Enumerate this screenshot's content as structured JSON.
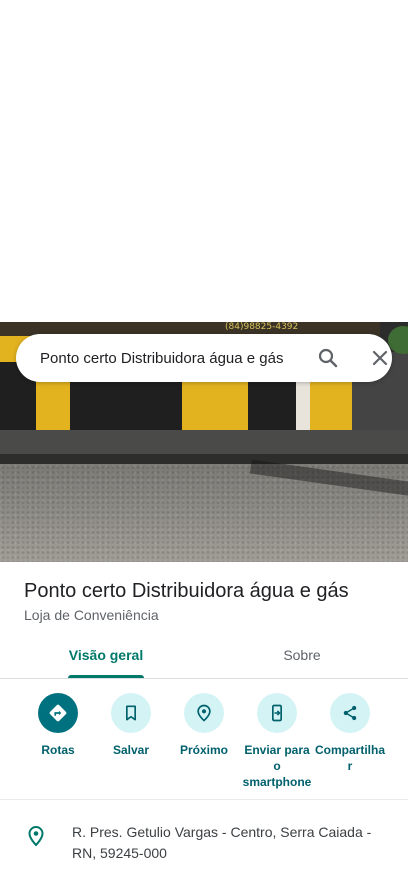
{
  "search": {
    "value": "Ponto certo Distribuidora água e gás",
    "icons": {
      "search": "search-icon",
      "close": "close-icon"
    }
  },
  "photo": {
    "sign_text": "(84)98825-4392"
  },
  "place": {
    "name": "Ponto certo Distribuidora água e gás",
    "category": "Loja de Conveniência"
  },
  "tabs": [
    {
      "label": "Visão geral",
      "selected": true
    },
    {
      "label": "Sobre",
      "selected": false
    }
  ],
  "actions": [
    {
      "label": "Rotas",
      "icon": "directions-icon"
    },
    {
      "label": "Salvar",
      "icon": "bookmark-icon"
    },
    {
      "label": "Próximo",
      "icon": "nearby-icon"
    },
    {
      "label": "Enviar para o smartphone",
      "icon": "send-to-phone-icon"
    },
    {
      "label": "Compartilhar",
      "icon": "share-icon"
    }
  ],
  "address": {
    "text": "R. Pres. Getulio Vargas - Centro, Serra Caiada - RN, 59245-000",
    "icon": "location-pin-icon"
  },
  "colors": {
    "accent": "#00796b",
    "action_bg": "#d3f3f5",
    "action_primary": "#00727f",
    "action_text": "#00606b"
  }
}
